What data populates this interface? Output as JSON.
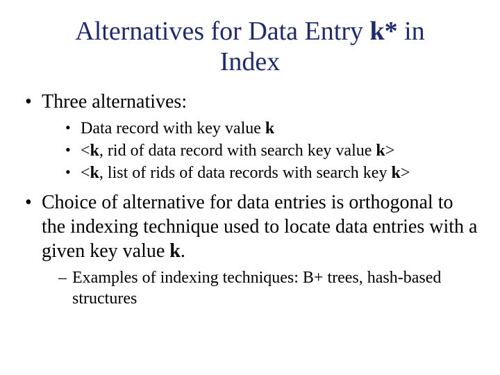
{
  "title_pre": "Alternatives for Data Entry ",
  "title_bold": "k*",
  "title_post": " in Index",
  "l1_item1": "Three alternatives:",
  "l2_item1_pre": "Data record with key value ",
  "l2_item1_b": "k",
  "l2_item2_pre": "<",
  "l2_item2_b1": "k",
  "l2_item2_mid": ", rid of data record with search key value ",
  "l2_item2_b2": "k",
  "l2_item2_post": ">",
  "l2_item3_pre": "<",
  "l2_item3_b1": "k",
  "l2_item3_mid": ", list of rids of data records with search key ",
  "l2_item3_b2": "k",
  "l2_item3_post": ">",
  "l1_item2_pre": "Choice of alternative for data entries is orthogonal to the indexing technique used to locate data entries with a given key value ",
  "l1_item2_b": "k",
  "l1_item2_post": ".",
  "l3_item1": "Examples of indexing techniques: B+ trees, hash-based structures"
}
